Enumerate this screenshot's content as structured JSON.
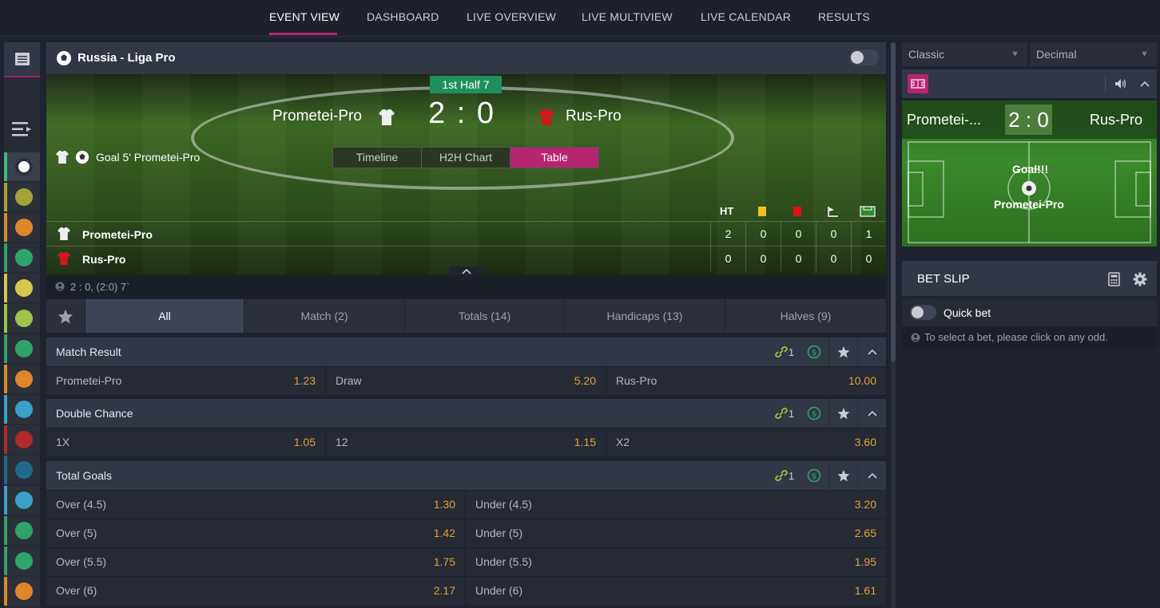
{
  "nav": {
    "items": [
      "EVENT VIEW",
      "DASHBOARD",
      "LIVE OVERVIEW",
      "LIVE MULTIVIEW",
      "LIVE CALENDAR",
      "RESULTS"
    ],
    "active": "EVENT VIEW",
    "accent": "#b6256f"
  },
  "sidebar": {
    "top_icon": "list-icon",
    "menu_icon": "menu-icon",
    "sports": [
      {
        "icon": "soccer-ball-icon",
        "color": "#3cb878"
      },
      {
        "icon": "tennis-ball-icon",
        "color": "#a5a23a"
      },
      {
        "icon": "basketball-icon",
        "color": "#e0862a"
      },
      {
        "icon": "table-tennis-icon",
        "color": "#2fa46a"
      },
      {
        "icon": "volleyball-icon",
        "color": "#d6c64a"
      },
      {
        "icon": "badminton-icon",
        "color": "#9cc44a"
      },
      {
        "icon": "cricket-icon",
        "color": "#2fa46a"
      },
      {
        "icon": "boxing-icon",
        "color": "#e0862a"
      },
      {
        "icon": "ice-hockey-icon",
        "color": "#3aa0c8"
      },
      {
        "icon": "esports-dota-icon",
        "color": "#b02a2a"
      },
      {
        "icon": "esports-lol-icon",
        "color": "#1f6a8a"
      },
      {
        "icon": "tablet-game-icon",
        "color": "#3aa0c8"
      },
      {
        "icon": "golf-icon",
        "color": "#2fa46a"
      },
      {
        "icon": "pool-ball-icon",
        "color": "#2fa46a"
      },
      {
        "icon": "basketball-3x3-icon",
        "color": "#e0862a"
      }
    ]
  },
  "event": {
    "league": "Russia - Liga Pro",
    "period": "1st Half 7",
    "home": "Prometei-Pro",
    "away": "Rus-Pro",
    "score_home": "2",
    "score_sep": ":",
    "score_away": "0",
    "last_event": "Goal 5' Prometei-Pro",
    "view_tabs": [
      "Timeline",
      "H2H Chart",
      "Table"
    ],
    "active_view_tab": "Table",
    "stats_header": [
      "HT",
      "yellow-card-icon",
      "red-card-icon",
      "corner-icon",
      "penalty-icon"
    ],
    "stats_rows": [
      {
        "team": "Prometei-Pro",
        "values": [
          "2",
          "0",
          "0",
          "0",
          "1"
        ]
      },
      {
        "team": "Rus-Pro",
        "values": [
          "0",
          "0",
          "0",
          "0",
          "0"
        ]
      }
    ],
    "summary": "2 : 0, (2:0) 7`"
  },
  "market_tabs": [
    "All",
    "Match (2)",
    "Totals (14)",
    "Handicaps (13)",
    "Halves (9)"
  ],
  "markets": [
    {
      "title": "Match Result",
      "link_count": "1",
      "rows": [
        [
          {
            "label": "Prometei-Pro",
            "odd": "1.23"
          },
          {
            "label": "Draw",
            "odd": "5.20"
          },
          {
            "label": "Rus-Pro",
            "odd": "10.00"
          }
        ]
      ]
    },
    {
      "title": "Double Chance",
      "link_count": "1",
      "rows": [
        [
          {
            "label": "1X",
            "odd": "1.05"
          },
          {
            "label": "12",
            "odd": "1.15"
          },
          {
            "label": "X2",
            "odd": "3.60"
          }
        ]
      ]
    },
    {
      "title": "Total Goals",
      "link_count": "1",
      "rows": [
        [
          {
            "label": "Over (4.5)",
            "odd": "1.30"
          },
          {
            "label": "Under (4.5)",
            "odd": "3.20"
          }
        ],
        [
          {
            "label": "Over (5)",
            "odd": "1.42"
          },
          {
            "label": "Under (5)",
            "odd": "2.65"
          }
        ],
        [
          {
            "label": "Over (5.5)",
            "odd": "1.75"
          },
          {
            "label": "Under (5.5)",
            "odd": "1.95"
          }
        ],
        [
          {
            "label": "Over (6)",
            "odd": "2.17"
          },
          {
            "label": "Under (6)",
            "odd": "1.61"
          }
        ]
      ]
    }
  ],
  "right": {
    "view_mode": "Classic",
    "odds_format": "Decimal",
    "live_home": "Prometei-...",
    "live_away": "Rus-Pro",
    "live_score": "2 : 0",
    "live_event": "Goal!!!",
    "live_team": "Prometei-Pro",
    "betslip_title": "BET SLIP",
    "quick_bet": "Quick bet",
    "hint": "To select a bet, please click on any odd."
  }
}
